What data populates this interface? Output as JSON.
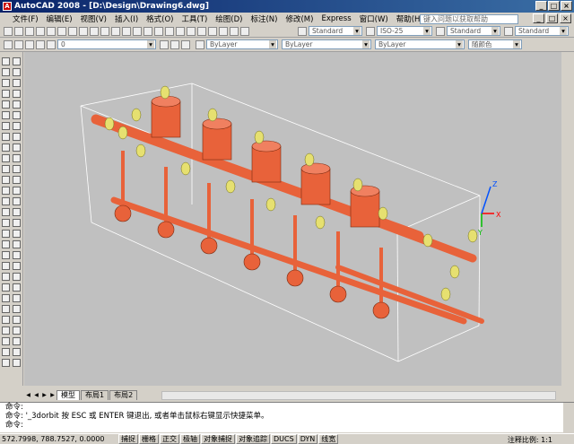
{
  "window": {
    "title": "AutoCAD 2008 - [D:\\Design\\Drawing6.dwg]",
    "app_icon": "A",
    "min": "_",
    "max": "□",
    "close": "×"
  },
  "menu": {
    "items": [
      "文件(F)",
      "编辑(E)",
      "视图(V)",
      "插入(I)",
      "格式(O)",
      "工具(T)",
      "绘图(D)",
      "标注(N)",
      "修改(M)",
      "Express",
      "窗口(W)",
      "帮助(H)"
    ],
    "help_placeholder": "键入问题以获取帮助"
  },
  "toolbar": {
    "text_style": "Standard",
    "dim_style": "ISO-25",
    "table_style": "Standard",
    "ml_style": "Standard",
    "color": "ByLayer",
    "linetype": "ByLayer",
    "lineweight": "ByLayer",
    "plot_style": "随颜色",
    "layer": "0"
  },
  "tabs": {
    "model": "模型",
    "layout1": "布局1",
    "layout2": "布局2"
  },
  "command": {
    "line1": "命令:",
    "line2": "命令: '_3dorbit 按 ESC 或 ENTER 键退出, 或者单击鼠标右键显示快捷菜单。",
    "line3": "命令:"
  },
  "status": {
    "coords": "572.7998,  788.7527,  0.0000",
    "buttons": [
      "捕捉",
      "栅格",
      "正交",
      "极轴",
      "对象捕捉",
      "对象追踪",
      "DUCS",
      "DYN",
      "线宽"
    ],
    "annotation_scale_label": "注释比例:",
    "annotation_scale": "1:1"
  },
  "ucs": {
    "x": "X",
    "y": "Y",
    "z": "Z"
  },
  "colors": {
    "pipe": "#e8623a",
    "valve": "#e6e070",
    "bg": "#c0c0c0"
  }
}
